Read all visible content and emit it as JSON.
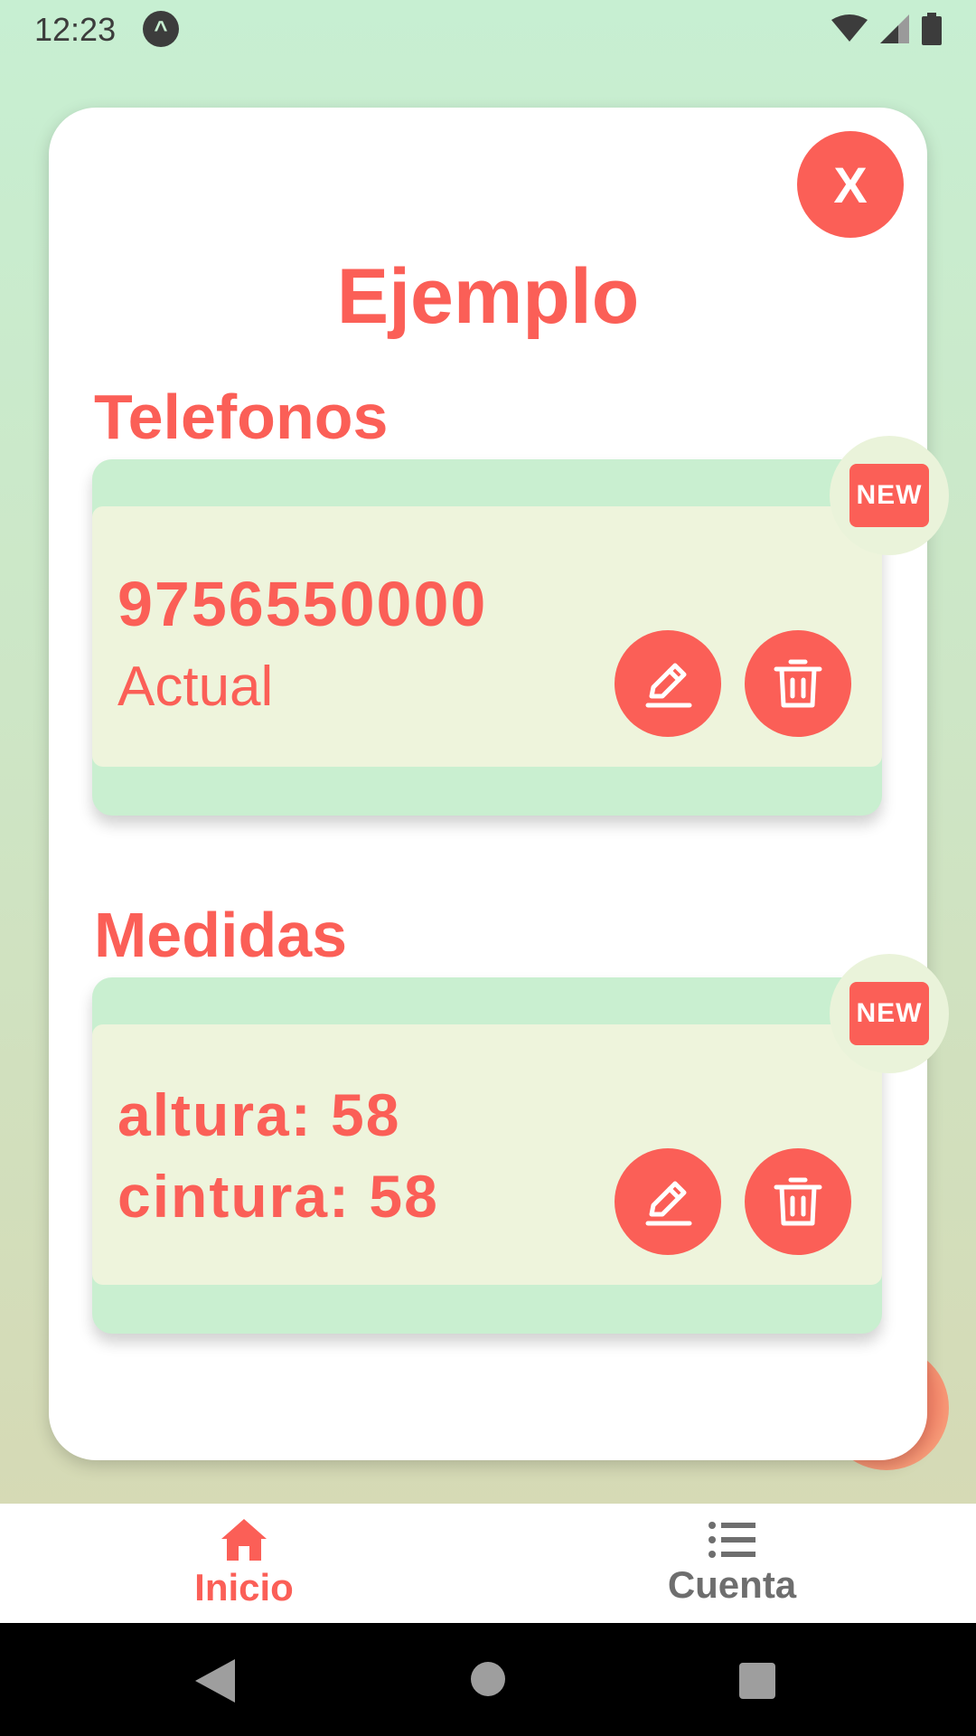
{
  "status_bar": {
    "time": "12:23",
    "app_icon_glyph": "^"
  },
  "modal": {
    "close_label": "X",
    "title": "Ejemplo"
  },
  "sections": [
    {
      "title": "Telefonos",
      "card": {
        "badge": "NEW",
        "primary": "9756550000",
        "secondary": "Actual"
      }
    },
    {
      "title": "Medidas",
      "card": {
        "badge": "NEW",
        "primary": "altura: 58",
        "secondary": "cintura: 58"
      }
    }
  ],
  "bottom_nav": {
    "items": [
      {
        "label": "Inicio",
        "icon": "home-icon",
        "active": true
      },
      {
        "label": "Cuenta",
        "icon": "list-icon",
        "active": false
      }
    ]
  },
  "colors": {
    "accent": "#fb5f57",
    "card_header": "#c9efd0",
    "card_body": "#eef4dc",
    "inactive_nav": "#6e6e6e"
  }
}
